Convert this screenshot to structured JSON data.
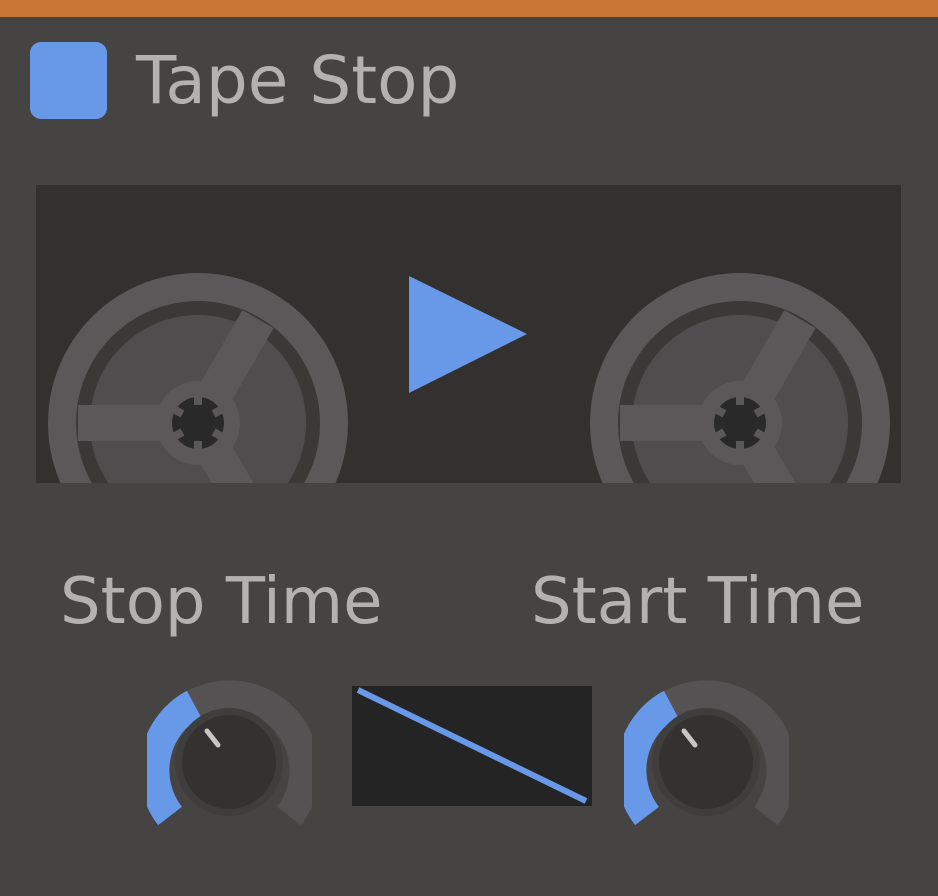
{
  "plugin": {
    "title": "Tape Stop",
    "power": {
      "state": "on"
    }
  },
  "transport": {
    "play_icon": "play-icon",
    "reel_icon": "tape-reel-icon"
  },
  "controls": {
    "stop_time": {
      "label": "Stop Time"
    },
    "start_time": {
      "label": "Start Time"
    },
    "curve": {
      "shape": "linear-descending"
    }
  },
  "colors": {
    "header_accent": "#c97734",
    "accent": "#6898e8",
    "panel_background": "#454443",
    "display_background": "#323130",
    "reel": "#5a5858",
    "text": "#b3b2b1"
  }
}
